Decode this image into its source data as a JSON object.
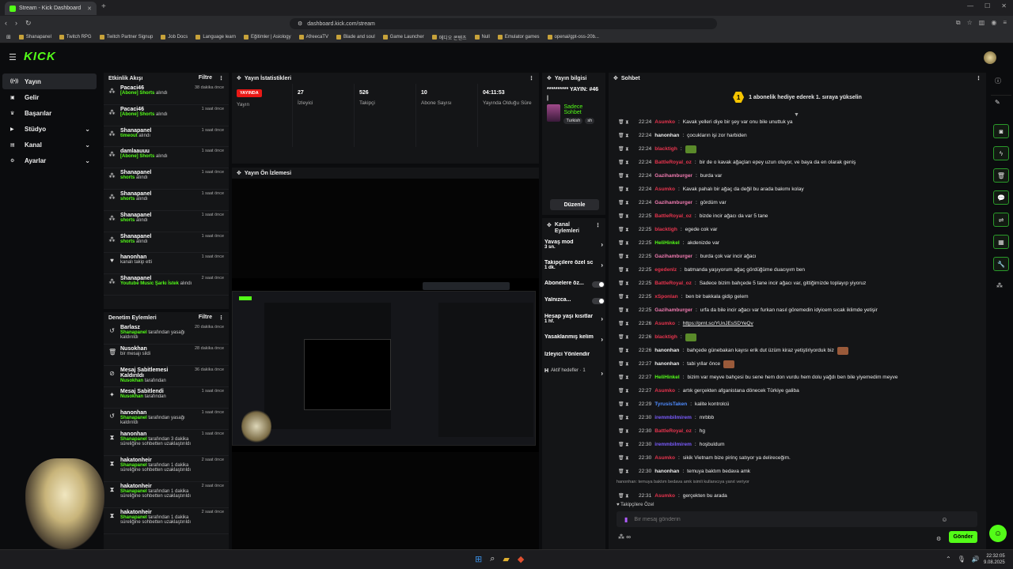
{
  "browser": {
    "tab_title": "Stream - Kick Dashboard",
    "url": "dashboard.kick.com/stream",
    "bookmarks": [
      "Shanapanel",
      "Twitch RPG",
      "Twitch Partner Signup",
      "Job Docs",
      "Language learn",
      "Eğitimler | Asiology",
      "AfreecaTV",
      "Blade and soul",
      "Game Launcher",
      "에디오 콘텐츠",
      "Null",
      "Emulator games",
      "openai/gpt-oss-20b..."
    ]
  },
  "app": {
    "logo": "KICK"
  },
  "sidebar": [
    {
      "label": "Yayın",
      "icon": "broadcast-icon",
      "active": true
    },
    {
      "label": "Gelir",
      "icon": "wallet-icon"
    },
    {
      "label": "Başarılar",
      "icon": "trophy-icon"
    },
    {
      "label": "Stüdyo",
      "icon": "studio-icon",
      "chevron": true
    },
    {
      "label": "Kanal",
      "icon": "channel-icon",
      "chevron": true
    },
    {
      "label": "Ayarlar",
      "icon": "gear-icon",
      "chevron": true
    }
  ],
  "activity": {
    "title": "Etkinlik Akışı",
    "filter": "Filtre",
    "items": [
      {
        "name": "Pacaci46",
        "action": "[Abone] Shorts",
        "suffix": "alındı",
        "time": "38 dakika önce"
      },
      {
        "name": "Pacaci46",
        "action": "[Abone] Shorts",
        "suffix": "alındı",
        "time": "1 saat önce"
      },
      {
        "name": "Shanapanel",
        "action": "timeout",
        "suffix": "alındı",
        "time": "1 saat önce"
      },
      {
        "name": "damlaauuu",
        "action": "[Abone] Shorts",
        "suffix": "alındı",
        "time": "1 saat önce"
      },
      {
        "name": "Shanapanel",
        "action": "shorts",
        "suffix": "alındı",
        "time": "1 saat önce"
      },
      {
        "name": "Shanapanel",
        "action": "shorts",
        "suffix": "alındı",
        "time": "1 saat önce"
      },
      {
        "name": "Shanapanel",
        "action": "shorts",
        "suffix": "alındı",
        "time": "1 saat önce"
      },
      {
        "name": "Shanapanel",
        "action": "shorts",
        "suffix": "alındı",
        "time": "1 saat önce"
      },
      {
        "name": "hanonhan",
        "action": "",
        "suffix": "kanalı takip etti",
        "time": "1 saat önce"
      },
      {
        "name": "Shanapanel",
        "action": "Youtube Music Şarkı İstek",
        "suffix": "alındı",
        "time": "2 saat önce"
      }
    ]
  },
  "moderation": {
    "title": "Denetim Eylemleri",
    "filter": "Filtre",
    "items": [
      {
        "name": "Barlasz",
        "actor": "Shanapanel",
        "text": "tarafından yasağı kaldırıldı",
        "time": "20 dakika önce",
        "icon": "unban-icon"
      },
      {
        "name": "Nusokhan",
        "actor": "",
        "text": "bir mesajı sildi",
        "time": "28 dakika önce",
        "icon": "trash-icon"
      },
      {
        "name": "Mesaj Sabitlemesi Kaldırıldı",
        "actor": "Nusokhan",
        "text": "tarafından",
        "time": "36 dakika önce",
        "icon": "unpin-icon"
      },
      {
        "name": "Mesaj Sabitlendi",
        "actor": "Nusokhan",
        "text": "tarafından",
        "time": "1 saat önce",
        "icon": "pin-icon"
      },
      {
        "name": "hanonhan",
        "actor": "Shanapanel",
        "text": "tarafından yasağı kaldırıldı",
        "time": "1 saat önce",
        "icon": "unban-icon"
      },
      {
        "name": "hanonhan",
        "actor": "Shanapanel",
        "text": "tarafından 3 dakika süreliğine sohbetten uzaklaştırıldı",
        "time": "1 saat önce",
        "icon": "hourglass-icon"
      },
      {
        "name": "hakatonheir",
        "actor": "Shanapanel",
        "text": "tarafından 1 dakika süreliğine sohbetten uzaklaştırıldı",
        "time": "2 saat önce",
        "icon": "hourglass-icon"
      },
      {
        "name": "hakatonheir",
        "actor": "Shanapanel",
        "text": "tarafından 1 dakika süreliğine sohbetten uzaklaştırıldı",
        "time": "2 saat önce",
        "icon": "hourglass-icon"
      },
      {
        "name": "hakatonheir",
        "actor": "Shanapanel",
        "text": "tarafından 1 dakika süreliğine sohbetten uzaklaştırıldı",
        "time": "2 saat önce",
        "icon": "hourglass-icon"
      }
    ]
  },
  "stats": {
    "title": "Yayın İstatistikleri",
    "live_badge": "YAYINDA",
    "live_label": "Yayın",
    "viewers": "27",
    "viewers_label": "İzleyici",
    "followers": "526",
    "followers_label": "Takipçi",
    "subs": "10",
    "subs_label": "Abone Sayısı",
    "duration": "04:11:53",
    "duration_label": "Yayında Olduğu Süre"
  },
  "preview": {
    "title": "Yayın Ön İzlemesi"
  },
  "streaminfo": {
    "title": "Yayın bilgisi",
    "stream_title": "********** YAYIN: #46 |",
    "category": "Sadece Sohbet",
    "tags": [
      "Turkish",
      "sh"
    ],
    "edit": "Düzenle"
  },
  "channel_actions": {
    "title": "Kanal Eylemleri",
    "items": [
      {
        "label": "Yavaş mod",
        "sub": "3 sn.",
        "type": "arrow"
      },
      {
        "label": "Takipçilere özel sc",
        "sub": "1 dk.",
        "type": "arrow"
      },
      {
        "label": "Abonelere öz...",
        "sub": "",
        "type": "toggle"
      },
      {
        "label": "Yalnızca...",
        "sub": "",
        "type": "toggle"
      },
      {
        "label": "Hesap yaşı kısıtlar",
        "sub": "1 hf.",
        "type": "arrow"
      },
      {
        "label": "Yasaklanmış kelim",
        "sub": "",
        "type": "arrow"
      },
      {
        "label": "İzleyici Yönlendir",
        "sub": "",
        "type": "none"
      },
      {
        "label": "H",
        "sub": "Aktif hedefler · 1",
        "type": "arrow"
      }
    ]
  },
  "chat": {
    "title": "Sohbet",
    "pinned": "1 abonelik hediye ederek 1. sıraya yükselin",
    "rank": "1",
    "messages": [
      {
        "time": "22:24",
        "user": "Asumko",
        "color": "#e8344e",
        "text": "Kavak yelleri diye bir şey var onu bile unuttuk ya"
      },
      {
        "time": "22:24",
        "user": "hanonhan",
        "color": "#f0f0f0",
        "text": "çocukların işi zor harbiden"
      },
      {
        "time": "22:24",
        "user": "blacktigh",
        "color": "#e8344e",
        "text": "",
        "emote": "#5a8a2a"
      },
      {
        "time": "22:24",
        "user": "BattleRoyal_oz",
        "color": "#e8344e",
        "text": "bir de o kavak ağaçları epey uzun oluyor, ve baya da en olarak geniş"
      },
      {
        "time": "22:24",
        "user": "Gazihamburger",
        "color": "#f07ab0",
        "text": "burda var"
      },
      {
        "time": "22:24",
        "user": "Asumko",
        "color": "#e8344e",
        "text": "Kavak pahalı bir ağaç da değil bu arada bakımı kolay"
      },
      {
        "time": "22:24",
        "user": "Gazihamburger",
        "color": "#f07ab0",
        "text": "gördüm var"
      },
      {
        "time": "22:25",
        "user": "BattleRoyal_oz",
        "color": "#e8344e",
        "text": "bizde incir ağacı da var 5 tane"
      },
      {
        "time": "22:25",
        "user": "blacktigh",
        "color": "#e8344e",
        "text": "egede cok var"
      },
      {
        "time": "22:25",
        "user": "HeliHinkel",
        "color": "#53fc18",
        "text": "akdenizde var"
      },
      {
        "time": "22:25",
        "user": "Gazihamburger",
        "color": "#f07ab0",
        "text": "burda çok var incir ağacı"
      },
      {
        "time": "22:25",
        "user": "egedenlz",
        "color": "#e8344e",
        "text": "batmanda yaşıyorum ağaç gördüğüme duacıyım ben"
      },
      {
        "time": "22:25",
        "user": "BattleRoyal_oz",
        "color": "#e8344e",
        "text": "Sadece bizim bahçede 5 tane incir ağacı var, gittiğimizde toplayıp yiyoruz"
      },
      {
        "time": "22:25",
        "user": "xSponlan",
        "color": "#e8344e",
        "text": "ben bir bakkala gidip gelem"
      },
      {
        "time": "22:25",
        "user": "Gazihamburger",
        "color": "#f07ab0",
        "text": "urfa da bile incir ağacı var furkan nasıl göremedin idyicem sıcak iklimde yetişir"
      },
      {
        "time": "22:26",
        "user": "Asumko",
        "color": "#e8344e",
        "text": "https://prnt.sc/YUnJEsSDYeQv"
      },
      {
        "time": "22:26",
        "user": "blacktigh",
        "color": "#e8344e",
        "text": "",
        "emote": "#5a8a2a"
      },
      {
        "time": "22:26",
        "user": "hanonhan",
        "color": "#f0f0f0",
        "text": "bahçede günebakan kayısı erik dut üzüm kiraz yetiştiriyorduk biz",
        "emote": "#9a5a3a"
      },
      {
        "time": "22:27",
        "user": "hanonhan",
        "color": "#f0f0f0",
        "text": "tabi yıllar önce",
        "emote": "#9a5a3a"
      },
      {
        "time": "22:27",
        "user": "HeliHinkel",
        "color": "#53fc18",
        "text": "bizim var meyve bahçesi bu sene hem don vurdu hem dolu yağdı ben bile yiyemedim meyve"
      },
      {
        "time": "22:27",
        "user": "Asumko",
        "color": "#e8344e",
        "text": "artık gerçekten afganistana dönecek Türkiye galiba"
      },
      {
        "time": "22:29",
        "user": "TyrusisTaken",
        "color": "#4f8cff",
        "text": "kalite kontrolcü"
      },
      {
        "time": "22:30",
        "user": "iremmbilmirem",
        "color": "#7b5cff",
        "text": "mrbbb"
      },
      {
        "time": "22:30",
        "user": "BattleRoyal_oz",
        "color": "#e8344e",
        "text": "hg"
      },
      {
        "time": "22:30",
        "user": "iremmbilmirem",
        "color": "#7b5cff",
        "text": "hoşbuldum"
      },
      {
        "time": "22:30",
        "user": "Asumko",
        "color": "#e8344e",
        "text": "sikik Vietnam bize pirinç satıyor ya delireceğim."
      },
      {
        "time": "22:30",
        "user": "hanonhan",
        "color": "#f0f0f0",
        "text": "temuya baktım bedava amk"
      }
    ],
    "reply_ref": "hanonhan: temuya baktım bedava amk isimli kullanıcıya yanıt veriyor",
    "last": {
      "time": "22:31",
      "user": "Asumko",
      "color": "#e8344e",
      "text": "gerçekten bu arada"
    },
    "followers_only": "Takipçilere Özel",
    "placeholder": "Bir mesaj gönderin",
    "send": "Gönder",
    "points": "∞"
  },
  "taskbar": {
    "time": "22:32:05",
    "date": "9.08.2025"
  }
}
